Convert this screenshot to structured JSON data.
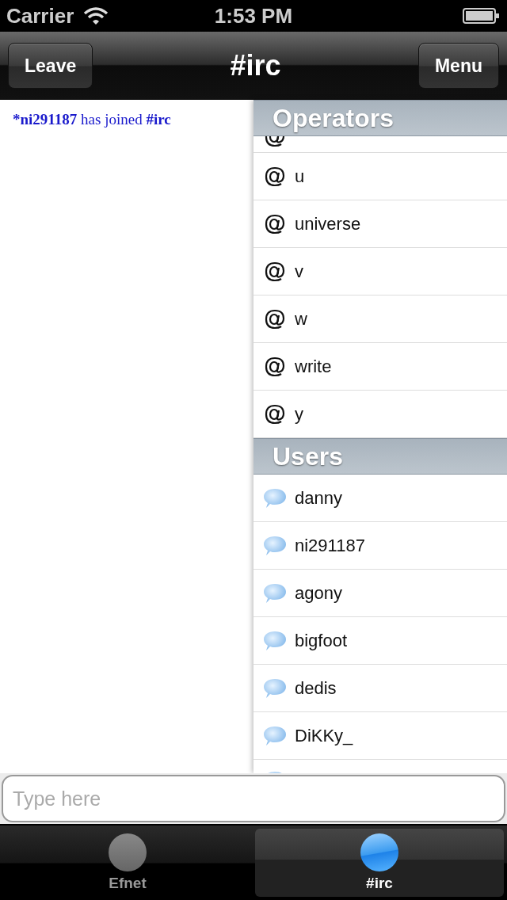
{
  "status_bar": {
    "carrier": "Carrier",
    "time": "1:53 PM"
  },
  "nav_bar": {
    "left_button": "Leave",
    "title": "#irc",
    "right_button": "Menu"
  },
  "messages": [
    {
      "text": "***ni291187** has joined **#irc**"
    }
  ],
  "user_list": {
    "sections": [
      {
        "title": "Operators",
        "kind": "operator",
        "cut_top": true,
        "cut_bottom": false,
        "members": [
          "u",
          "universe",
          "v",
          "w",
          "write",
          "y"
        ]
      },
      {
        "title": "Users",
        "kind": "user",
        "cut_top": false,
        "cut_bottom": true,
        "members": [
          "danny",
          "ni291187",
          "agony",
          "bigfoot",
          "dedis",
          "DiKKy_"
        ]
      }
    ]
  },
  "input": {
    "placeholder": "Type here"
  },
  "tabs": [
    {
      "label": "Efnet",
      "selected": false
    },
    {
      "label": "#irc",
      "selected": true
    }
  ]
}
